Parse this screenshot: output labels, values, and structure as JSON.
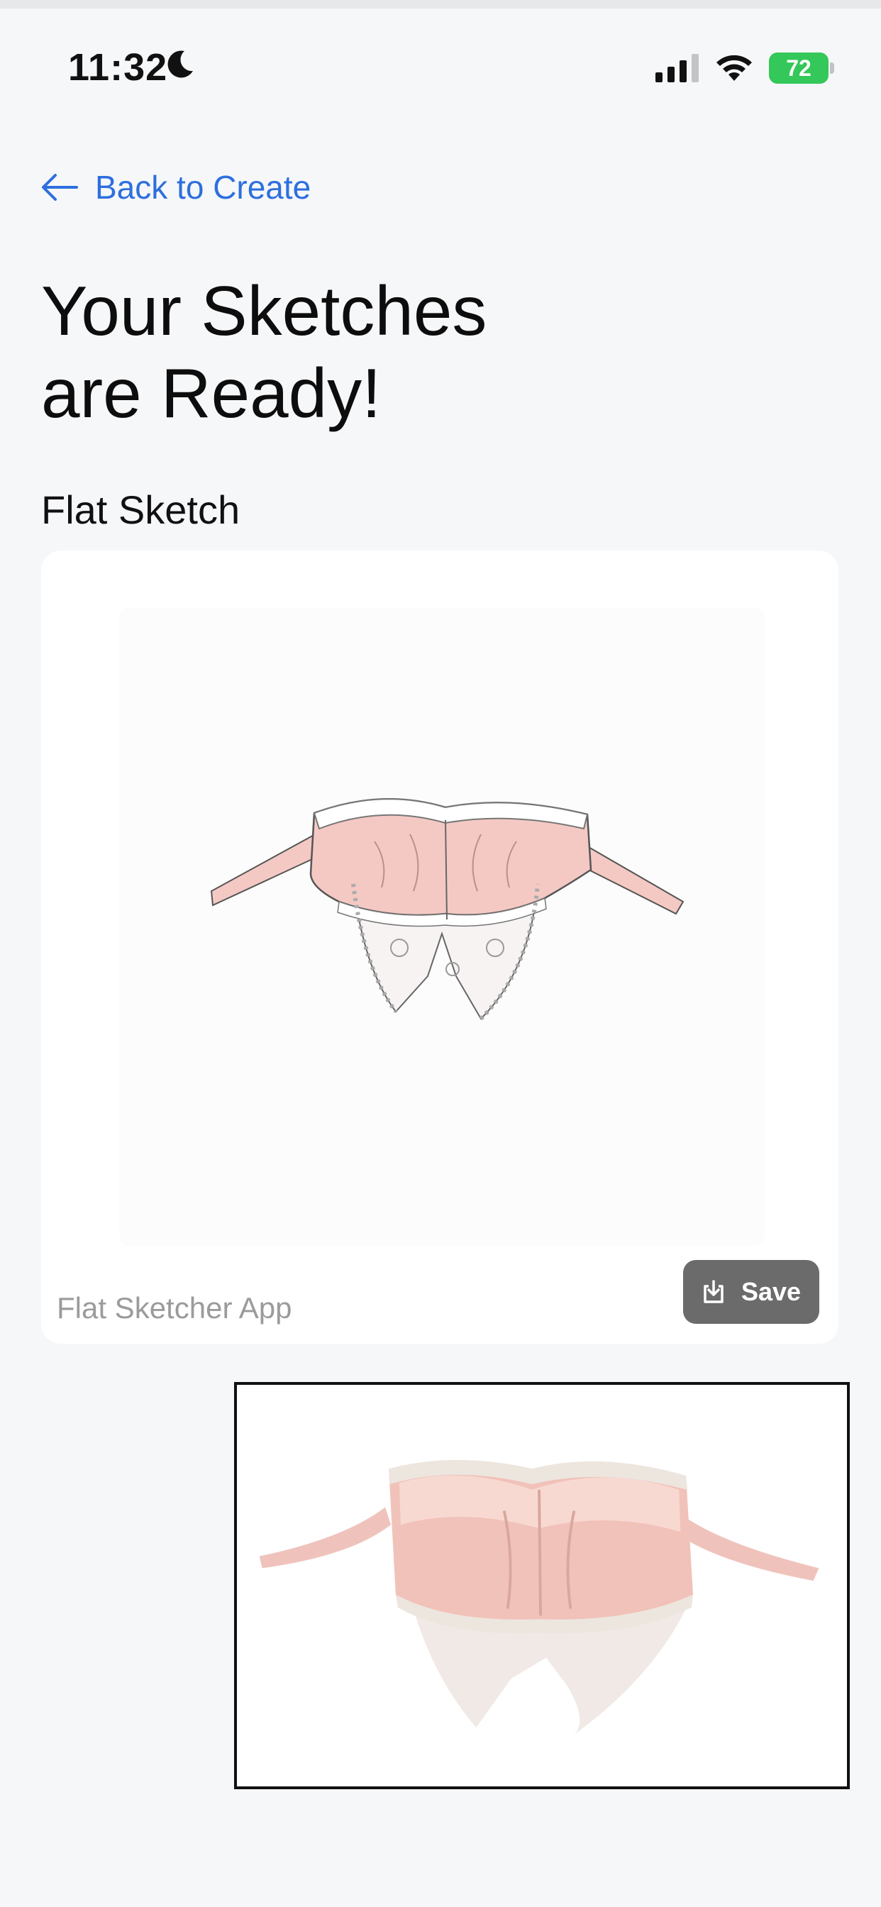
{
  "status_bar": {
    "time": "11:32",
    "battery": "72",
    "icons": [
      "moon-icon",
      "signal-icon",
      "wifi-icon",
      "battery-icon"
    ]
  },
  "nav": {
    "back_label": "Back to Create",
    "back_icon": "arrow-left-icon"
  },
  "header": {
    "title_line1": "Your Sketches",
    "title_line2": "are Ready!"
  },
  "flat_sketch": {
    "section_title": "Flat Sketch",
    "watermark": "Flat Sketcher App",
    "save_label": "Save",
    "save_icon": "download-icon"
  },
  "colors": {
    "accent": "#2e6fde",
    "background": "#f6f7f9",
    "battery": "#34c759",
    "garment_pink": "#f4c9c4",
    "save_button": "#6b6b6b"
  }
}
